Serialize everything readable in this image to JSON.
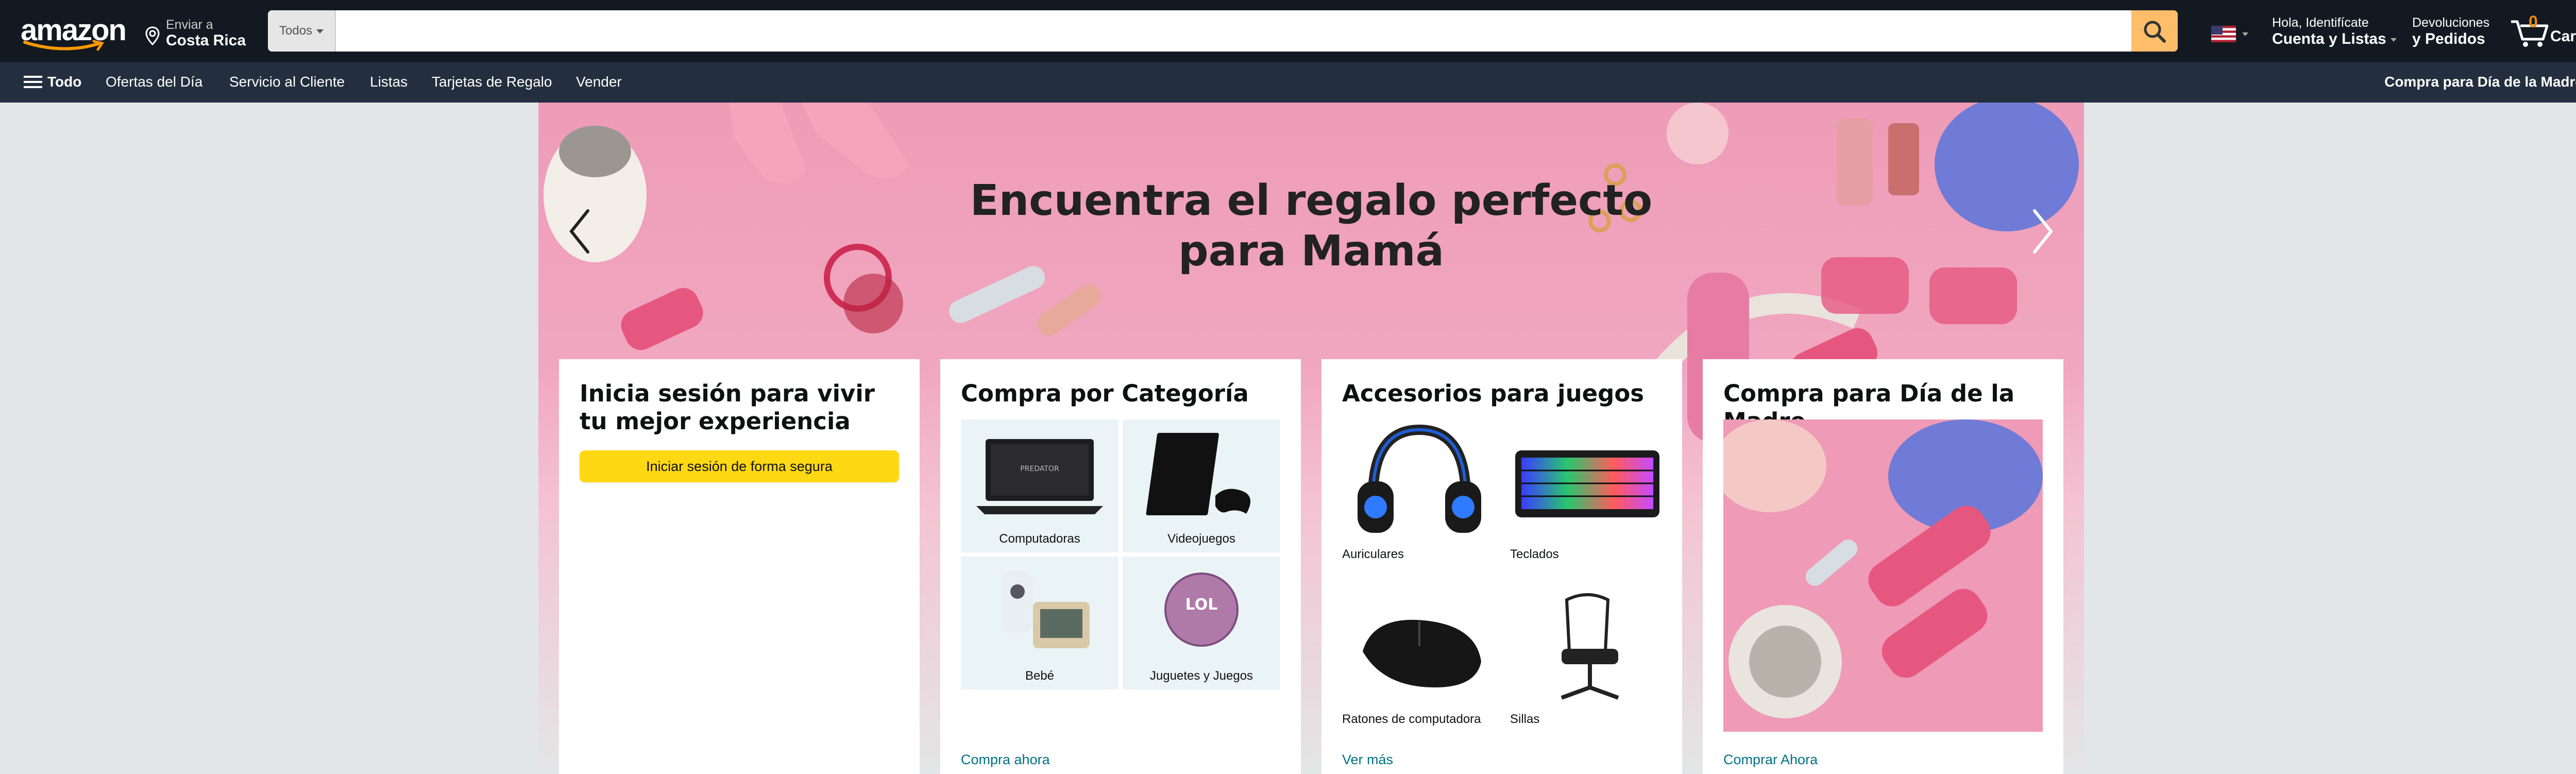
{
  "header": {
    "logo": "amazon",
    "deliver_line1": "Enviar a",
    "deliver_line2": "Costa Rica",
    "search_category": "Todos",
    "search_placeholder": "",
    "account_line1": "Hola, Identifícate",
    "account_line2": "Cuenta y Listas",
    "returns_line1": "Devoluciones",
    "returns_line2": "y Pedidos",
    "cart_count": "0",
    "cart_label": "Carrito",
    "flag": "us-flag-icon"
  },
  "nav": {
    "all_label": "Todo",
    "items": [
      "Ofertas del Día",
      "Servicio al Cliente",
      "Listas",
      "Tarjetas de Regalo",
      "Vender"
    ],
    "right_label": "Compra para Día de la Madre"
  },
  "hero": {
    "title_line1": "Encuentra el regalo perfecto",
    "title_line2": "para Mamá"
  },
  "cards": {
    "signin": {
      "title": "Inicia sesión para vivir tu mejor experiencia",
      "button": "Iniciar sesión de forma segura"
    },
    "category": {
      "title": "Compra por Categoría",
      "items": [
        "Computadoras",
        "Videojuegos",
        "Bebé",
        "Juguetes y Juegos"
      ],
      "link": "Compra ahora"
    },
    "gaming": {
      "title": "Accesorios para juegos",
      "items": [
        "Auriculares",
        "Teclados",
        "Ratones de computadora",
        "Sillas"
      ],
      "link": "Ver más"
    },
    "mothers": {
      "title": "Compra para Día de la Madre",
      "link": "Comprar Ahora"
    }
  }
}
